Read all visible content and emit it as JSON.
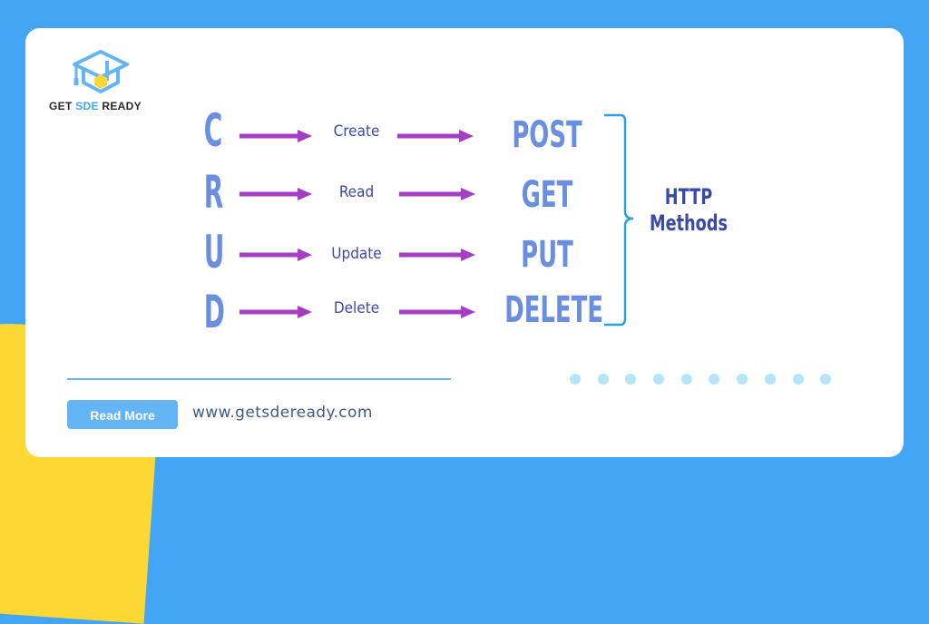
{
  "brand": {
    "name_prefix": "GET ",
    "name_accent": "SDE",
    "name_suffix": " READY",
    "primary_color": "#42a5f5",
    "accent_yellow": "#fdd835"
  },
  "diagram": {
    "crud_letters": [
      "C",
      "R",
      "U",
      "D"
    ],
    "operations": [
      "Create",
      "Read",
      "Update",
      "Delete"
    ],
    "http_methods": [
      "POST",
      "GET",
      "PUT",
      "DELETE"
    ],
    "group_label_line1": "HTTP",
    "group_label_line2": "Methods",
    "arrow_color": "#a43fc4",
    "letter_color": "#6a8ee0",
    "label_color": "#3b4aa6"
  },
  "footer": {
    "read_more_label": "Read More",
    "website": "www.getsdeready.com",
    "dot_count": 10
  }
}
